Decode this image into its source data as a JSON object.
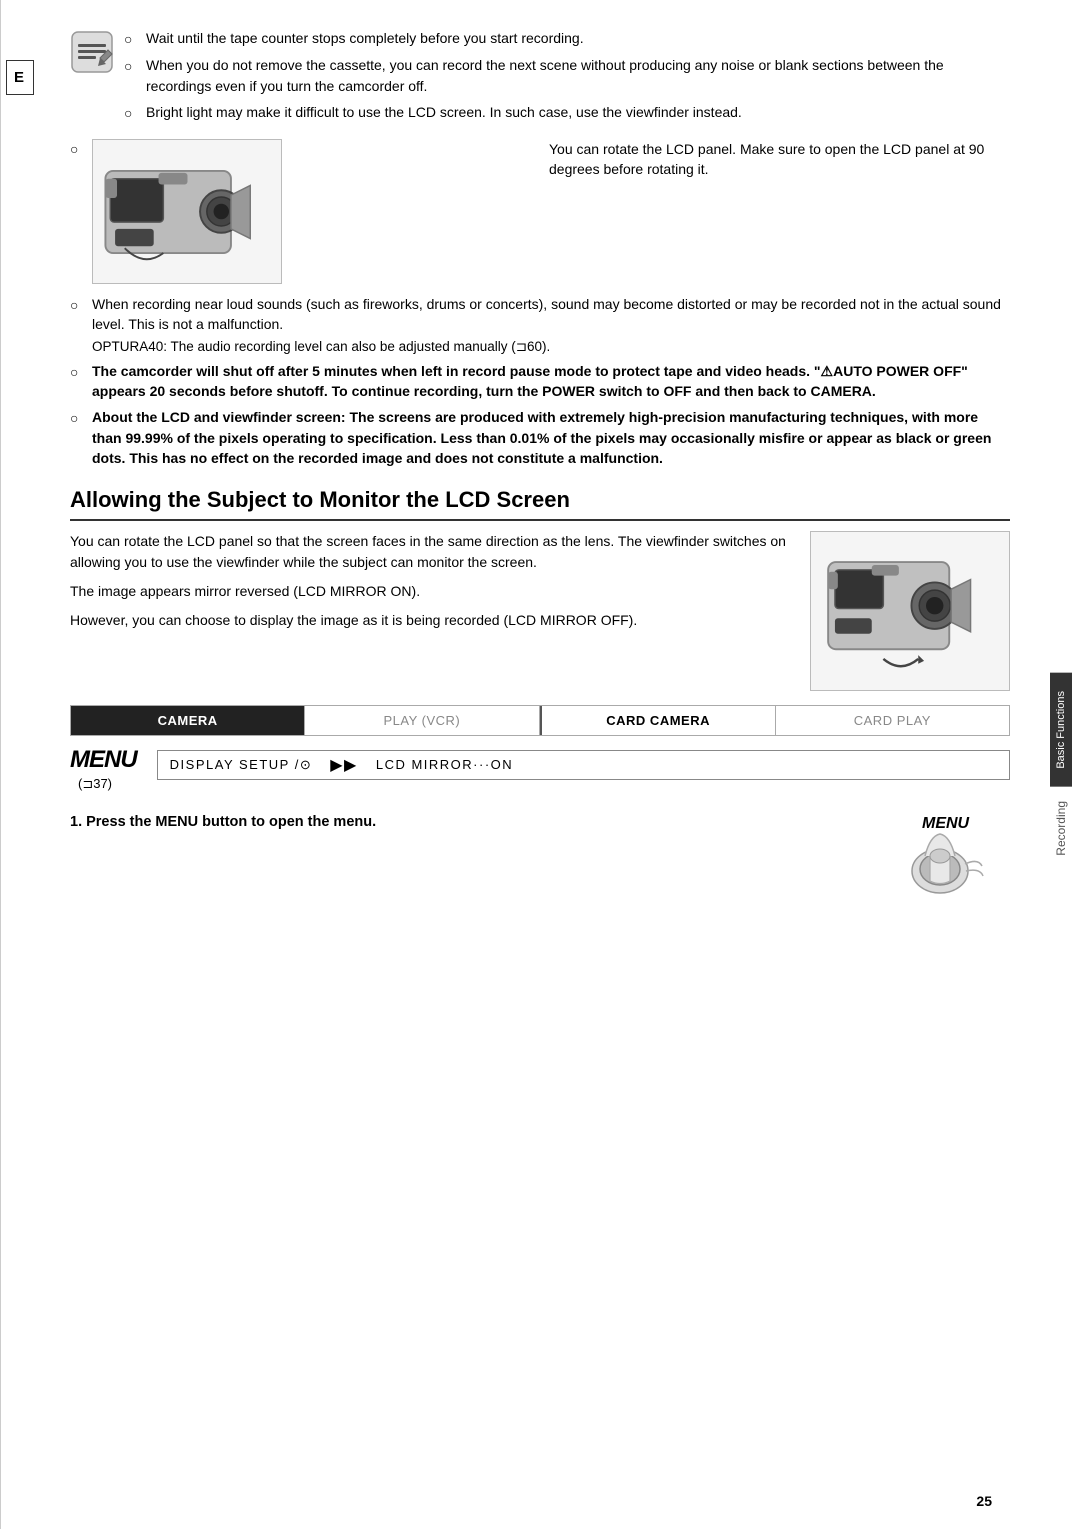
{
  "page": {
    "number": "25",
    "tab_e": "E"
  },
  "sidebar": {
    "label_basic": "Basic Functions",
    "label_recording": "Recording"
  },
  "bullets": [
    {
      "id": "b1",
      "text": "Wait until the tape counter stops completely before you start recording."
    },
    {
      "id": "b2",
      "text": "When you do not remove the cassette, you can record the next scene without producing any noise or blank sections between the recordings even if you turn the camcorder off."
    },
    {
      "id": "b3",
      "text": "Bright light may make it difficult to use the LCD screen. In such case, use the viewfinder instead."
    }
  ],
  "camera_note": "You can rotate the LCD panel. Make sure to open the LCD panel at 90 degrees before rotating it.",
  "bullets2": [
    {
      "id": "b4",
      "text": "When recording near loud sounds (such as fireworks, drums or concerts), sound may become distorted or may be recorded not in the actual sound level. This is not a malfunction."
    }
  ],
  "optura_note": "OPTURA40: The audio recording level can also be adjusted manually (⊐60).",
  "bold_bullets": [
    {
      "id": "bb1",
      "text": "The camcorder will shut off after 5 minutes when left in record pause mode to protect tape and video heads. \"⚠AUTO POWER OFF\" appears 20 seconds before shutoff. To continue recording, turn the POWER switch to OFF and then back to CAMERA."
    },
    {
      "id": "bb2",
      "text": "About the LCD and viewfinder screen: The screens are produced with extremely high-precision manufacturing techniques, with more than 99.99% of the pixels operating to specification. Less than 0.01% of the pixels may occasionally misfire or appear as black or green dots. This has no effect on the recorded image and does not constitute a malfunction."
    }
  ],
  "section": {
    "heading": "Allowing the Subject to Monitor the LCD Screen",
    "body_text": [
      "You can rotate the LCD panel so that the screen faces in the same direction as the lens. The viewfinder switches on allowing you to use the viewfinder while the subject can monitor the screen.",
      "The image appears mirror reversed (LCD MIRROR ON).",
      "However, you can choose to display the image as it is being recorded (LCD MIRROR OFF)."
    ]
  },
  "mode_bar": {
    "items": [
      {
        "label": "CAMERA",
        "state": "active"
      },
      {
        "label": "PLAY (VCR)",
        "state": "inactive"
      },
      {
        "label": "CARD CAMERA",
        "state": "semi"
      },
      {
        "label": "CARD PLAY",
        "state": "inactive_light"
      }
    ]
  },
  "menu": {
    "logo": "MENU",
    "display_left": "DISPLAY SETUP /⊙",
    "display_right": "LCD MIRROR···ON",
    "ref": "(⊐37)"
  },
  "step1": {
    "text": "1.  Press the MENU button to open the menu."
  }
}
